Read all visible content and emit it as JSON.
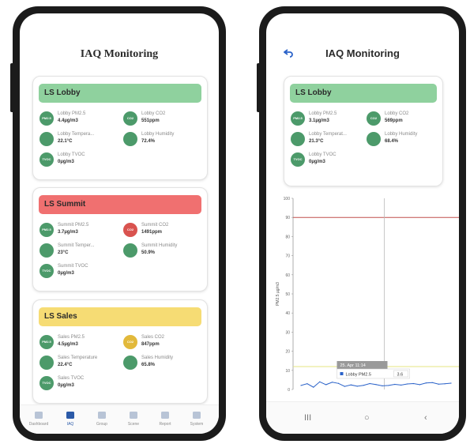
{
  "left_screen": {
    "title": "IAQ Monitoring",
    "cards": [
      {
        "name": "LS Lobby",
        "header_color": "#8fd19e",
        "metrics": [
          {
            "name": "Lobby PM2.5",
            "value": "4.4µg/m3",
            "icon": "pm25-icon",
            "icon_text": "PM2.5",
            "color": "#4c9a6a"
          },
          {
            "name": "Lobby CO2",
            "value": "551ppm",
            "icon": "co2-icon",
            "icon_text": "CO2",
            "color": "#4c9a6a"
          },
          {
            "name": "Lobby Tempera...",
            "value": "22.1°C",
            "icon": "thermometer-icon",
            "icon_text": "",
            "color": "#4c9a6a"
          },
          {
            "name": "Lobby Humidity",
            "value": "72.4%",
            "icon": "humidity-icon",
            "icon_text": "",
            "color": "#4c9a6a"
          },
          {
            "name": "Lobby TVOC",
            "value": "0µg/m3",
            "icon": "tvoc-icon",
            "icon_text": "TVOC",
            "color": "#4c9a6a"
          }
        ]
      },
      {
        "name": "LS Summit",
        "header_color": "#f07070",
        "metrics": [
          {
            "name": "Summit PM2.5",
            "value": "3.7µg/m3",
            "icon": "pm25-icon",
            "icon_text": "PM2.5",
            "color": "#4c9a6a"
          },
          {
            "name": "Summit CO2",
            "value": "1491ppm",
            "icon": "co2-icon",
            "icon_text": "CO2",
            "color": "#d9534f"
          },
          {
            "name": "Summit Temper...",
            "value": "23°C",
            "icon": "thermometer-icon",
            "icon_text": "",
            "color": "#4c9a6a"
          },
          {
            "name": "Summit Humidity",
            "value": "50.9%",
            "icon": "humidity-icon",
            "icon_text": "",
            "color": "#4c9a6a"
          },
          {
            "name": "Summit TVOC",
            "value": "0µg/m3",
            "icon": "tvoc-icon",
            "icon_text": "TVOC",
            "color": "#4c9a6a"
          }
        ]
      },
      {
        "name": "LS Sales",
        "header_color": "#f6dc74",
        "metrics": [
          {
            "name": "Sales PM2.5",
            "value": "4.5µg/m3",
            "icon": "pm25-icon",
            "icon_text": "PM2.5",
            "color": "#4c9a6a"
          },
          {
            "name": "Sales CO2",
            "value": "847ppm",
            "icon": "co2-icon",
            "icon_text": "CO2",
            "color": "#e2b93b"
          },
          {
            "name": "Sales Temperature",
            "value": "22.4°C",
            "icon": "thermometer-icon",
            "icon_text": "",
            "color": "#4c9a6a"
          },
          {
            "name": "Sales Humidity",
            "value": "65.8%",
            "icon": "humidity-icon",
            "icon_text": "",
            "color": "#4c9a6a"
          },
          {
            "name": "Sales TVOC",
            "value": "0µg/m3",
            "icon": "tvoc-icon",
            "icon_text": "TVOC",
            "color": "#4c9a6a"
          }
        ]
      }
    ],
    "nav": [
      {
        "label": "Dashboard",
        "icon": "dashboard-icon",
        "active": false
      },
      {
        "label": "IAQ",
        "icon": "iaq-icon",
        "active": true
      },
      {
        "label": "Group",
        "icon": "group-icon",
        "active": false
      },
      {
        "label": "Scene",
        "icon": "scene-icon",
        "active": false
      },
      {
        "label": "Report",
        "icon": "report-icon",
        "active": false
      },
      {
        "label": "System",
        "icon": "settings-icon",
        "active": false
      }
    ]
  },
  "right_screen": {
    "title": "IAQ Monitoring",
    "back_icon": "back-arrow-icon",
    "card": {
      "name": "LS Lobby",
      "header_color": "#8fd19e",
      "metrics": [
        {
          "name": "Lobby PM2.5",
          "value": "3.1µg/m3",
          "icon": "pm25-icon",
          "icon_text": "PM2.5",
          "color": "#4c9a6a"
        },
        {
          "name": "Lobby CO2",
          "value": "569ppm",
          "icon": "co2-icon",
          "icon_text": "CO2",
          "color": "#4c9a6a"
        },
        {
          "name": "Lobby Temperat...",
          "value": "21.3°C",
          "icon": "thermometer-icon",
          "icon_text": "",
          "color": "#4c9a6a"
        },
        {
          "name": "Lobby Humidity",
          "value": "68.4%",
          "icon": "humidity-icon",
          "icon_text": "",
          "color": "#4c9a6a"
        },
        {
          "name": "Lobby TVOC",
          "value": "0µg/m3",
          "icon": "tvoc-icon",
          "icon_text": "TVOC",
          "color": "#4c9a6a"
        }
      ]
    },
    "tooltip": {
      "date": "25. Apr 11:14",
      "series": "Lobby PM2.5",
      "value": "3.6"
    },
    "sys_nav": [
      {
        "label": "III",
        "icon": "recent-apps-icon"
      },
      {
        "label": "○",
        "icon": "home-icon"
      },
      {
        "label": "‹",
        "icon": "back-icon"
      }
    ]
  },
  "chart_data": {
    "type": "line",
    "ylabel": "PM2.5 µg/m3",
    "ylim": [
      0,
      100
    ],
    "yticks": [
      "0",
      "10",
      "20",
      "30",
      "40",
      "50",
      "60",
      "70",
      "80",
      "90",
      "100"
    ],
    "thresholds": [
      {
        "value": 90,
        "color": "#c0504d"
      },
      {
        "value": 12,
        "color": "#e6e680"
      }
    ],
    "crosshair_x": 0.55,
    "series": [
      {
        "name": "Lobby PM2.5",
        "color": "#2a62c9",
        "values": [
          2.1,
          3.0,
          1.2,
          4.0,
          2.5,
          3.8,
          3.2,
          1.6,
          2.4,
          1.7,
          2.2,
          3.1,
          2.6,
          1.9,
          2.1,
          2.7,
          2.3,
          2.9,
          3.1,
          2.5,
          3.4,
          3.6,
          2.8,
          3.0,
          3.3
        ]
      }
    ]
  }
}
